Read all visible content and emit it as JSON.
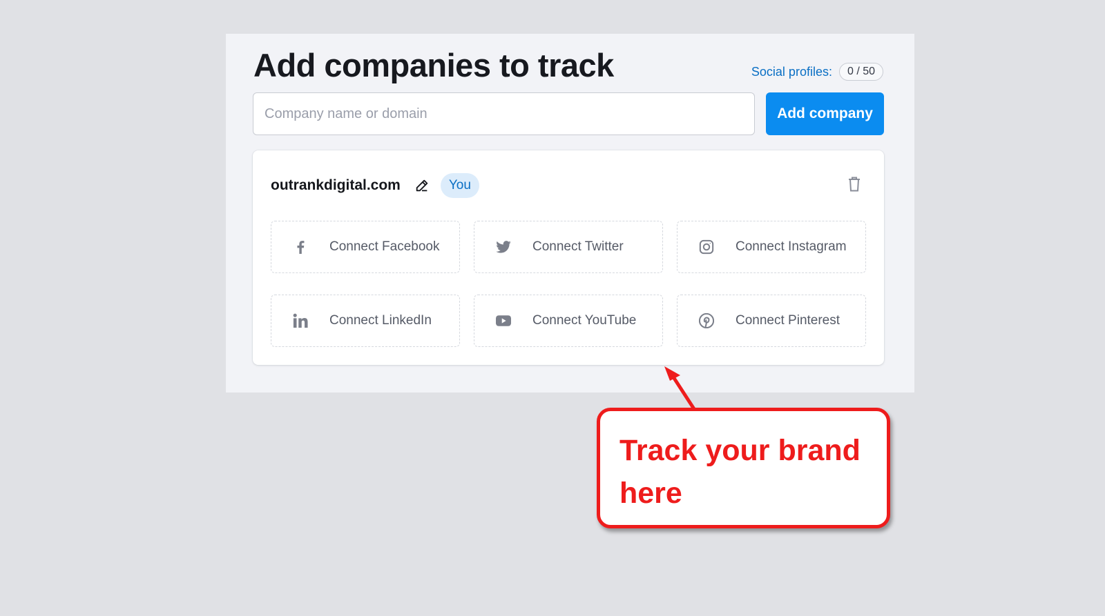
{
  "header": {
    "title": "Add companies to track",
    "social_profiles_label": "Social profiles:",
    "social_profiles_count": "0 / 50"
  },
  "search": {
    "placeholder": "Company name or domain",
    "button_label": "Add company"
  },
  "company": {
    "domain": "outrankdigital.com",
    "badge": "You",
    "connections": [
      {
        "label": "Connect Facebook",
        "icon": "facebook-icon"
      },
      {
        "label": "Connect Twitter",
        "icon": "twitter-icon"
      },
      {
        "label": "Connect Instagram",
        "icon": "instagram-icon"
      },
      {
        "label": "Connect LinkedIn",
        "icon": "linkedin-icon"
      },
      {
        "label": "Connect YouTube",
        "icon": "youtube-icon"
      },
      {
        "label": "Connect Pinterest",
        "icon": "pinterest-icon"
      }
    ]
  },
  "annotation": {
    "line1": "Track your brand",
    "line2": "here",
    "color": "#ee1c1c"
  },
  "colors": {
    "accent": "#0b8cf0",
    "link": "#0a6fc4",
    "badge_bg": "#dcecfb"
  }
}
